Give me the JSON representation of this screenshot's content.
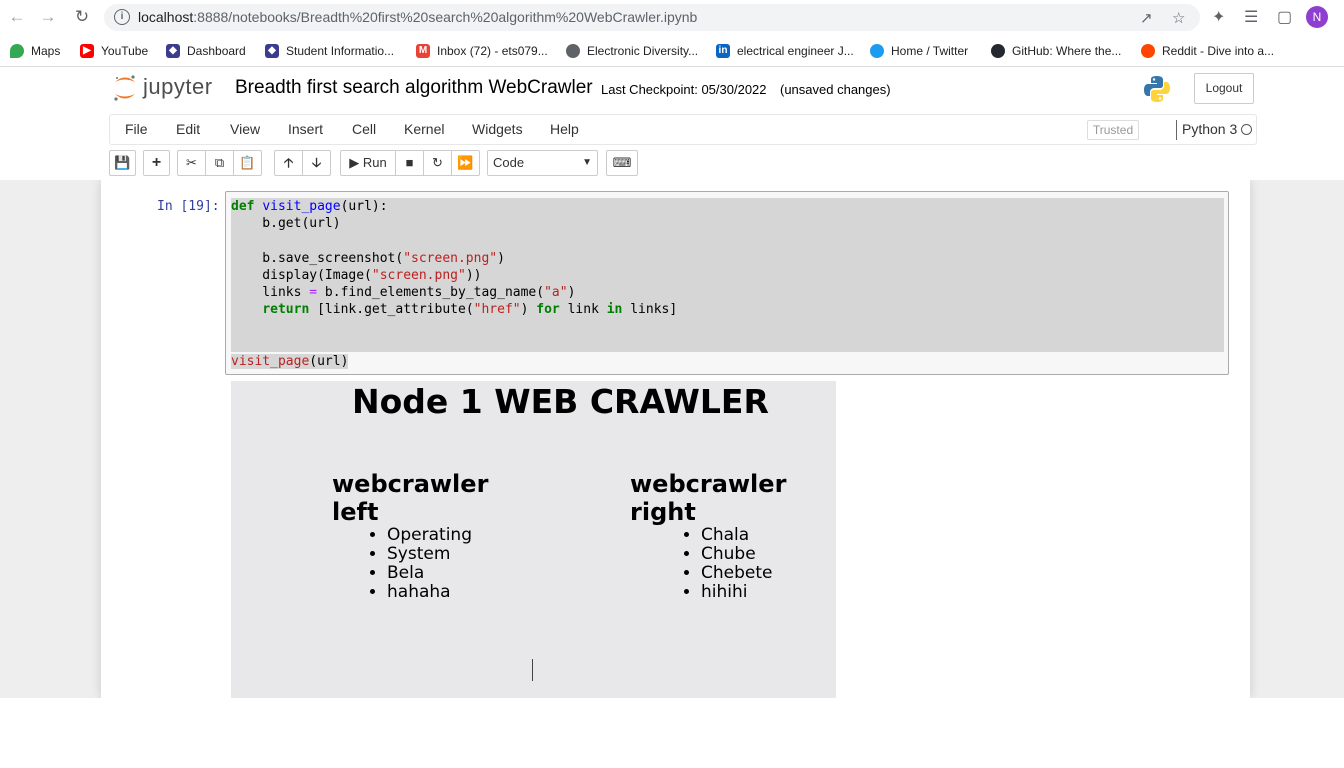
{
  "browser": {
    "url_host": "localhost",
    "url_rest": ":8888/notebooks/Breadth%20first%20search%20algorithm%20WebCrawler.ipynb",
    "avatar_letter": "N",
    "bookmarks": [
      {
        "label": "Maps",
        "color": "#34a853"
      },
      {
        "label": "YouTube",
        "color": "#ff0000"
      },
      {
        "label": "Dashboard",
        "color": "#3c3c8f"
      },
      {
        "label": "Student Informatio...",
        "color": "#3c3c8f"
      },
      {
        "label": "Inbox (72) - ets079...",
        "color": "#ea4335"
      },
      {
        "label": "Electronic Diversity...",
        "color": "#5f6368"
      },
      {
        "label": "electrical engineer J...",
        "color": "#0a66c2"
      },
      {
        "label": "Home / Twitter",
        "color": "#1d9bf0"
      },
      {
        "label": "GitHub: Where the...",
        "color": "#24292f"
      },
      {
        "label": "Reddit - Dive into a...",
        "color": "#ff4500"
      }
    ]
  },
  "jupyter": {
    "logo_text": "jupyter",
    "notebook_title": "Breadth first search algorithm WebCrawler",
    "checkpoint": "Last Checkpoint: 05/30/2022",
    "unsaved": "(unsaved changes)",
    "logout": "Logout",
    "menu": [
      "File",
      "Edit",
      "View",
      "Insert",
      "Cell",
      "Kernel",
      "Widgets",
      "Help"
    ],
    "trusted": "Trusted",
    "kernel": "Python 3",
    "run_label": "Run",
    "cell_type": "Code"
  },
  "cell": {
    "prompt": "In [19]:",
    "last_line_fn": "visit_page",
    "last_line_args": "(url)"
  },
  "output": {
    "title": "Node 1 WEB CRAWLER",
    "left": {
      "title_line1": "webcrawler",
      "title_line2": "left",
      "items": [
        "Operating",
        "System",
        "Bela",
        "hahaha"
      ]
    },
    "right": {
      "title_line1": "webcrawler",
      "title_line2": "right",
      "items": [
        "Chala",
        "Chube",
        "Chebete",
        "hihihi"
      ]
    }
  }
}
